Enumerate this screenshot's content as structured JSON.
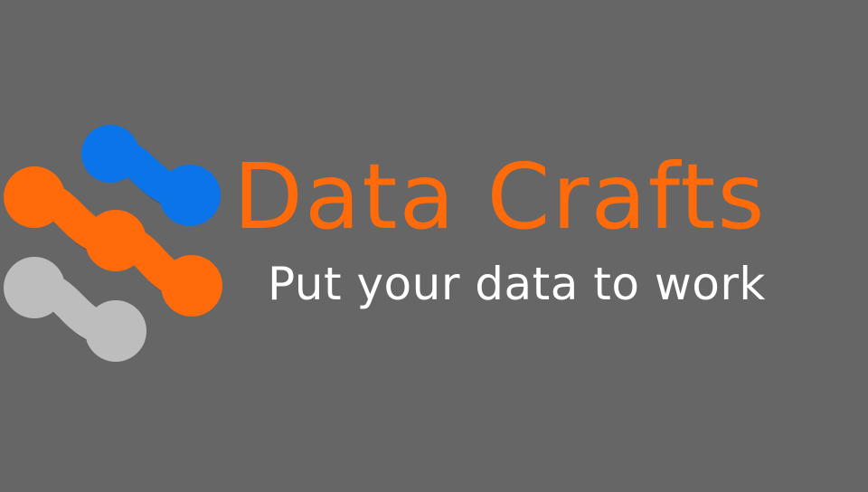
{
  "brand": {
    "name": "Data Crafts",
    "tagline": "Put your data to work"
  },
  "colors": {
    "background": "#666666",
    "brand_orange": "#FF6A0A",
    "logo_blue": "#0A74E8",
    "logo_orange": "#FF6A0A",
    "logo_gray": "#BDBDBD",
    "tagline_white": "#FFFFFF"
  },
  "logo": {
    "icon": "connected-nodes-icon"
  }
}
